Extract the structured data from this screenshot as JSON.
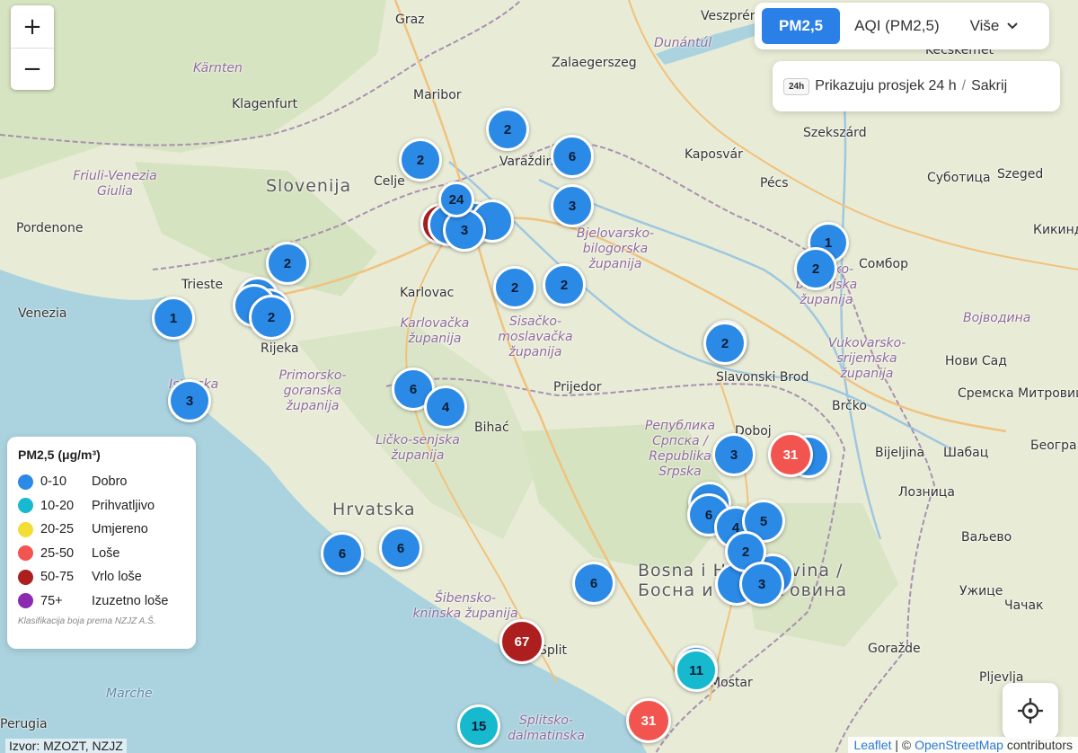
{
  "header": {
    "tabs": [
      {
        "label": "PM2,5",
        "active": true
      },
      {
        "label": "AQI (PM2,5)",
        "active": false
      },
      {
        "label": "Više",
        "active": false
      }
    ],
    "avg_badge": "24h",
    "avg_text": "Prikazuju prosjek 24 h",
    "avg_separator": "/",
    "avg_hide": "Sakrij"
  },
  "zoom": {
    "in": "+",
    "out": "−"
  },
  "legend": {
    "title": "PM2,5 (μg/m³)",
    "items": [
      {
        "range": "0-10",
        "label": "Dobro",
        "color": "#2b8ae6"
      },
      {
        "range": "10-20",
        "label": "Prihvatljivo",
        "color": "#17b9cf"
      },
      {
        "range": "20-25",
        "label": "Umjereno",
        "color": "#f3de36"
      },
      {
        "range": "25-50",
        "label": "Loše",
        "color": "#f2544f"
      },
      {
        "range": "50-75",
        "label": "Vrlo loše",
        "color": "#ad1f1f"
      },
      {
        "range": "75+",
        "label": "Izuzetno loše",
        "color": "#8c2bb1"
      }
    ],
    "note": "Klasifikacija boja prema NZJZ A.Š."
  },
  "source": "Izvor: MZOZT, NZJZ",
  "attribution": {
    "leaflet": "Leaflet",
    "sep": "| ©",
    "osm": "OpenStreetMap",
    "tail": "contributors"
  },
  "colors": {
    "good": "#2b8ae6",
    "acceptable": "#17b9cf",
    "bad": "#f2544f",
    "very_bad": "#ad1f1f"
  },
  "places": [
    {
      "name": "Graz",
      "kind": "city"
    },
    {
      "name": "Veszprém",
      "kind": "city"
    },
    {
      "name": "Dunántúl",
      "kind": "region"
    },
    {
      "name": "Kärnten",
      "kind": "region"
    },
    {
      "name": "Klagenfurt",
      "kind": "city"
    },
    {
      "name": "Maribor",
      "kind": "city"
    },
    {
      "name": "Zalaegerszeg",
      "kind": "city"
    },
    {
      "name": "Kecskemét",
      "kind": "city"
    },
    {
      "name": "Szekszárd",
      "kind": "city"
    },
    {
      "name": "Kaposvár",
      "kind": "city"
    },
    {
      "name": "Varaždin",
      "kind": "city"
    },
    {
      "name": "Szeged",
      "kind": "city"
    },
    {
      "name": "Pécs",
      "kind": "city"
    },
    {
      "name": "Суботица",
      "kind": "city"
    },
    {
      "name": "Friuli-Venezia Giulia",
      "kind": "region"
    },
    {
      "name": "Slovenija",
      "kind": "country"
    },
    {
      "name": "Celje",
      "kind": "city"
    },
    {
      "name": "Pordenone",
      "kind": "city"
    },
    {
      "name": "Bjelovarsko-bilogorska županija",
      "kind": "region"
    },
    {
      "name": "Кикинда",
      "kind": "city"
    },
    {
      "name": "Сомбор",
      "kind": "city"
    },
    {
      "name": "Osječko-baranjska županija",
      "kind": "region"
    },
    {
      "name": "Trieste",
      "kind": "city"
    },
    {
      "name": "Karlovac",
      "kind": "city"
    },
    {
      "name": "Venezia",
      "kind": "city"
    },
    {
      "name": "Sisačko-moslavačka županija",
      "kind": "region"
    },
    {
      "name": "Karlovačka županija",
      "kind": "region"
    },
    {
      "name": "Rijeka",
      "kind": "city"
    },
    {
      "name": "Војводина",
      "kind": "region"
    },
    {
      "name": "Vukovarsko-srijemska županija",
      "kind": "region"
    },
    {
      "name": "Primorsko-goranska županija",
      "kind": "region"
    },
    {
      "name": "Slavonski Brod",
      "kind": "city"
    },
    {
      "name": "Нови Сад",
      "kind": "city"
    },
    {
      "name": "Prijedor",
      "kind": "city"
    },
    {
      "name": "Istarska",
      "kind": "region"
    },
    {
      "name": "Сремска Митровица",
      "kind": "city"
    },
    {
      "name": "Bihać",
      "kind": "city"
    },
    {
      "name": "Brčko",
      "kind": "city"
    },
    {
      "name": "Ličko-senjska županija",
      "kind": "region"
    },
    {
      "name": "Република Српска / Republika Srpska",
      "kind": "region"
    },
    {
      "name": "Doboj",
      "kind": "city"
    },
    {
      "name": "Bijeljina",
      "kind": "city"
    },
    {
      "name": "Шабац",
      "kind": "city"
    },
    {
      "name": "Београ",
      "kind": "city"
    },
    {
      "name": "Hrvatska",
      "kind": "country"
    },
    {
      "name": "Лозница",
      "kind": "city"
    },
    {
      "name": "Ваљево",
      "kind": "city"
    },
    {
      "name": "Bosna i Hercegovina / Босна и Херцеговина",
      "kind": "country"
    },
    {
      "name": "Ужице",
      "kind": "city"
    },
    {
      "name": "Чачак",
      "kind": "city"
    },
    {
      "name": "Šibensko-kninska županija",
      "kind": "region"
    },
    {
      "name": "Goražde",
      "kind": "city"
    },
    {
      "name": "Split",
      "kind": "city"
    },
    {
      "name": "Mostar",
      "kind": "city"
    },
    {
      "name": "Pljevlja",
      "kind": "city"
    },
    {
      "name": "Marche",
      "kind": "sea"
    },
    {
      "name": "Perugia",
      "kind": "city"
    },
    {
      "name": "Splitsko-dalmatinska",
      "kind": "region"
    }
  ],
  "stations": [
    {
      "value": "2",
      "level": "good"
    },
    {
      "value": "2",
      "level": "good"
    },
    {
      "value": "6",
      "level": "good"
    },
    {
      "value": "3",
      "level": "good"
    },
    {
      "value": "3",
      "level": "good"
    },
    {
      "value": "2",
      "level": "good"
    },
    {
      "value": "1",
      "level": "good"
    },
    {
      "value": "2",
      "level": "good"
    },
    {
      "value": "2",
      "level": "good"
    },
    {
      "value": "2",
      "level": "good"
    },
    {
      "value": "1",
      "level": "good"
    },
    {
      "value": "2",
      "level": "good"
    },
    {
      "value": "2",
      "level": "good"
    },
    {
      "value": "3",
      "level": "good"
    },
    {
      "value": "6",
      "level": "good"
    },
    {
      "value": "4",
      "level": "good"
    },
    {
      "value": "3",
      "level": "good"
    },
    {
      "value": "31",
      "level": "bad"
    },
    {
      "value": "6",
      "level": "good"
    },
    {
      "value": "4",
      "level": "good"
    },
    {
      "value": "5",
      "level": "good"
    },
    {
      "value": "2",
      "level": "good"
    },
    {
      "value": "3",
      "level": "good"
    },
    {
      "value": "6",
      "level": "good"
    },
    {
      "value": "6",
      "level": "good"
    },
    {
      "value": "6",
      "level": "good"
    },
    {
      "value": "67",
      "level": "very_bad"
    },
    {
      "value": "11",
      "level": "acceptable"
    },
    {
      "value": "15",
      "level": "acceptable"
    },
    {
      "value": "31",
      "level": "bad"
    },
    {
      "value": "24",
      "level": "good"
    }
  ]
}
